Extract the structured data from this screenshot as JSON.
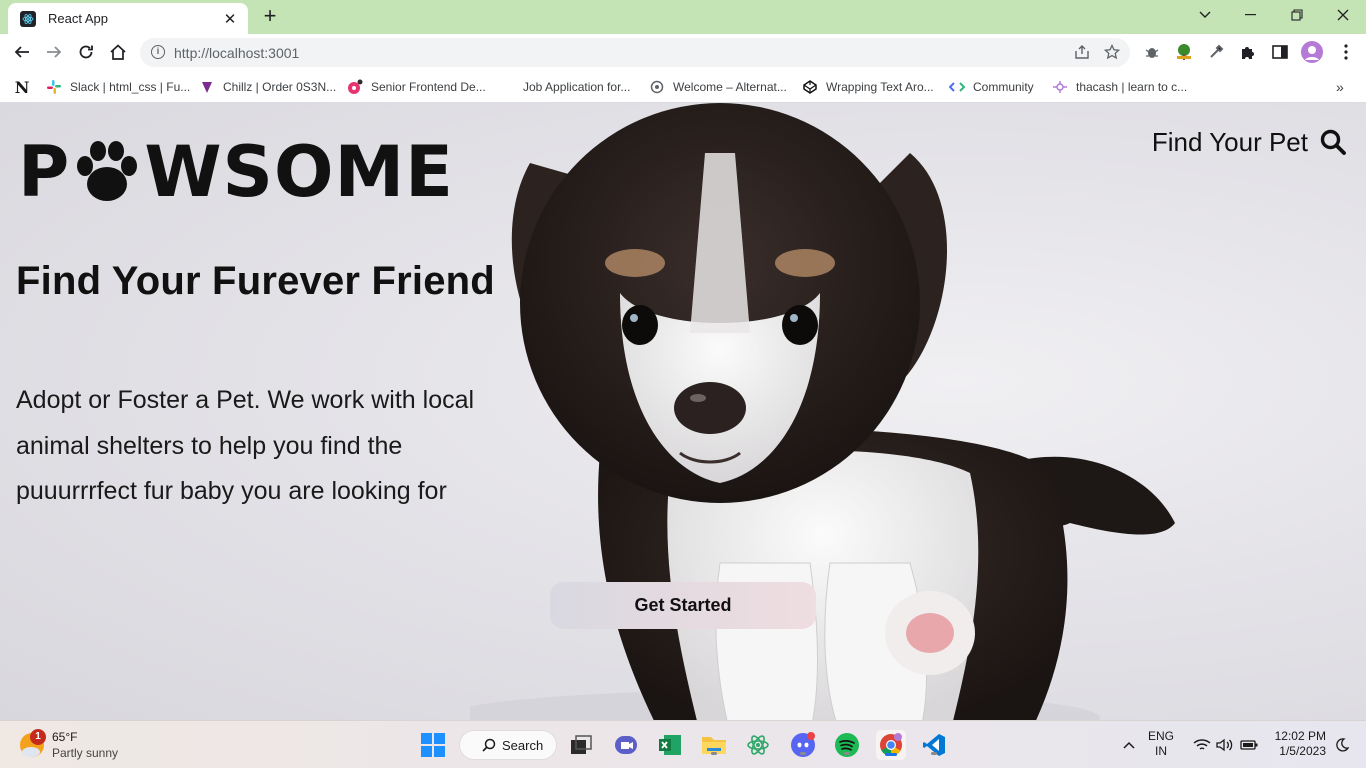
{
  "browser": {
    "tab_title": "React App",
    "url": "http://localhost:3001",
    "bookmarks": [
      "Slack | html_css | Fu...",
      "Chillz | Order 0S3N...",
      "Senior Frontend De...",
      "Job Application for...",
      "Welcome – Alternat...",
      "Wrapping Text Aro...",
      "Community",
      "thacash | learn to c..."
    ],
    "bookmark_n_label": "N"
  },
  "page": {
    "logo_left": "P",
    "logo_right": "WSOME",
    "nav_link": "Find Your Pet",
    "headline": "Find Your Furever Friend",
    "tagline": "Adopt or Foster a Pet. We work with local animal shelters to help you find the puuurrrfect fur baby you are looking for",
    "cta_label": "Get Started"
  },
  "taskbar": {
    "weather_badge": "1",
    "weather_temp": "65°F",
    "weather_desc": "Partly sunny",
    "search_label": "Search",
    "lang_line1": "ENG",
    "lang_line2": "IN",
    "time": "12:02 PM",
    "date": "1/5/2023"
  },
  "colors": {
    "tabbar_bg": "#c5e4b5",
    "accent_text": "#111111",
    "cta_gradient_start": "#d9d8e0",
    "cta_gradient_end": "#efdde0"
  }
}
